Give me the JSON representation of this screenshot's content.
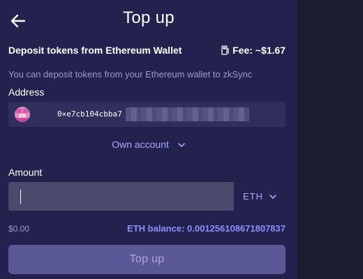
{
  "header": {
    "title": "Top up",
    "back_icon": "arrow-left-icon"
  },
  "deposit": {
    "subtitle": "Deposit tokens from Ethereum Wallet",
    "fee_label": "Fee: ~$1.67",
    "fee_icon": "gas-pump-icon",
    "description": "You can deposit tokens from your Ethereum wallet to zkSync"
  },
  "address": {
    "label": "Address",
    "value_visible": "0×e7cb104cbba7",
    "value_obscured": true,
    "own_account_label": "Own account",
    "own_account_icon": "chevron-down-icon"
  },
  "amount": {
    "label": "Amount",
    "value": "",
    "token": "ETH",
    "token_icon": "chevron-down-icon",
    "usd_value": "$0.00",
    "balance_label": "ETH balance: 0.001256108671807837"
  },
  "actions": {
    "submit_label": "Top up"
  },
  "colors": {
    "panel_bg": "#23224f",
    "accent": "#a9a8ff",
    "button_bg": "#5a5896"
  }
}
